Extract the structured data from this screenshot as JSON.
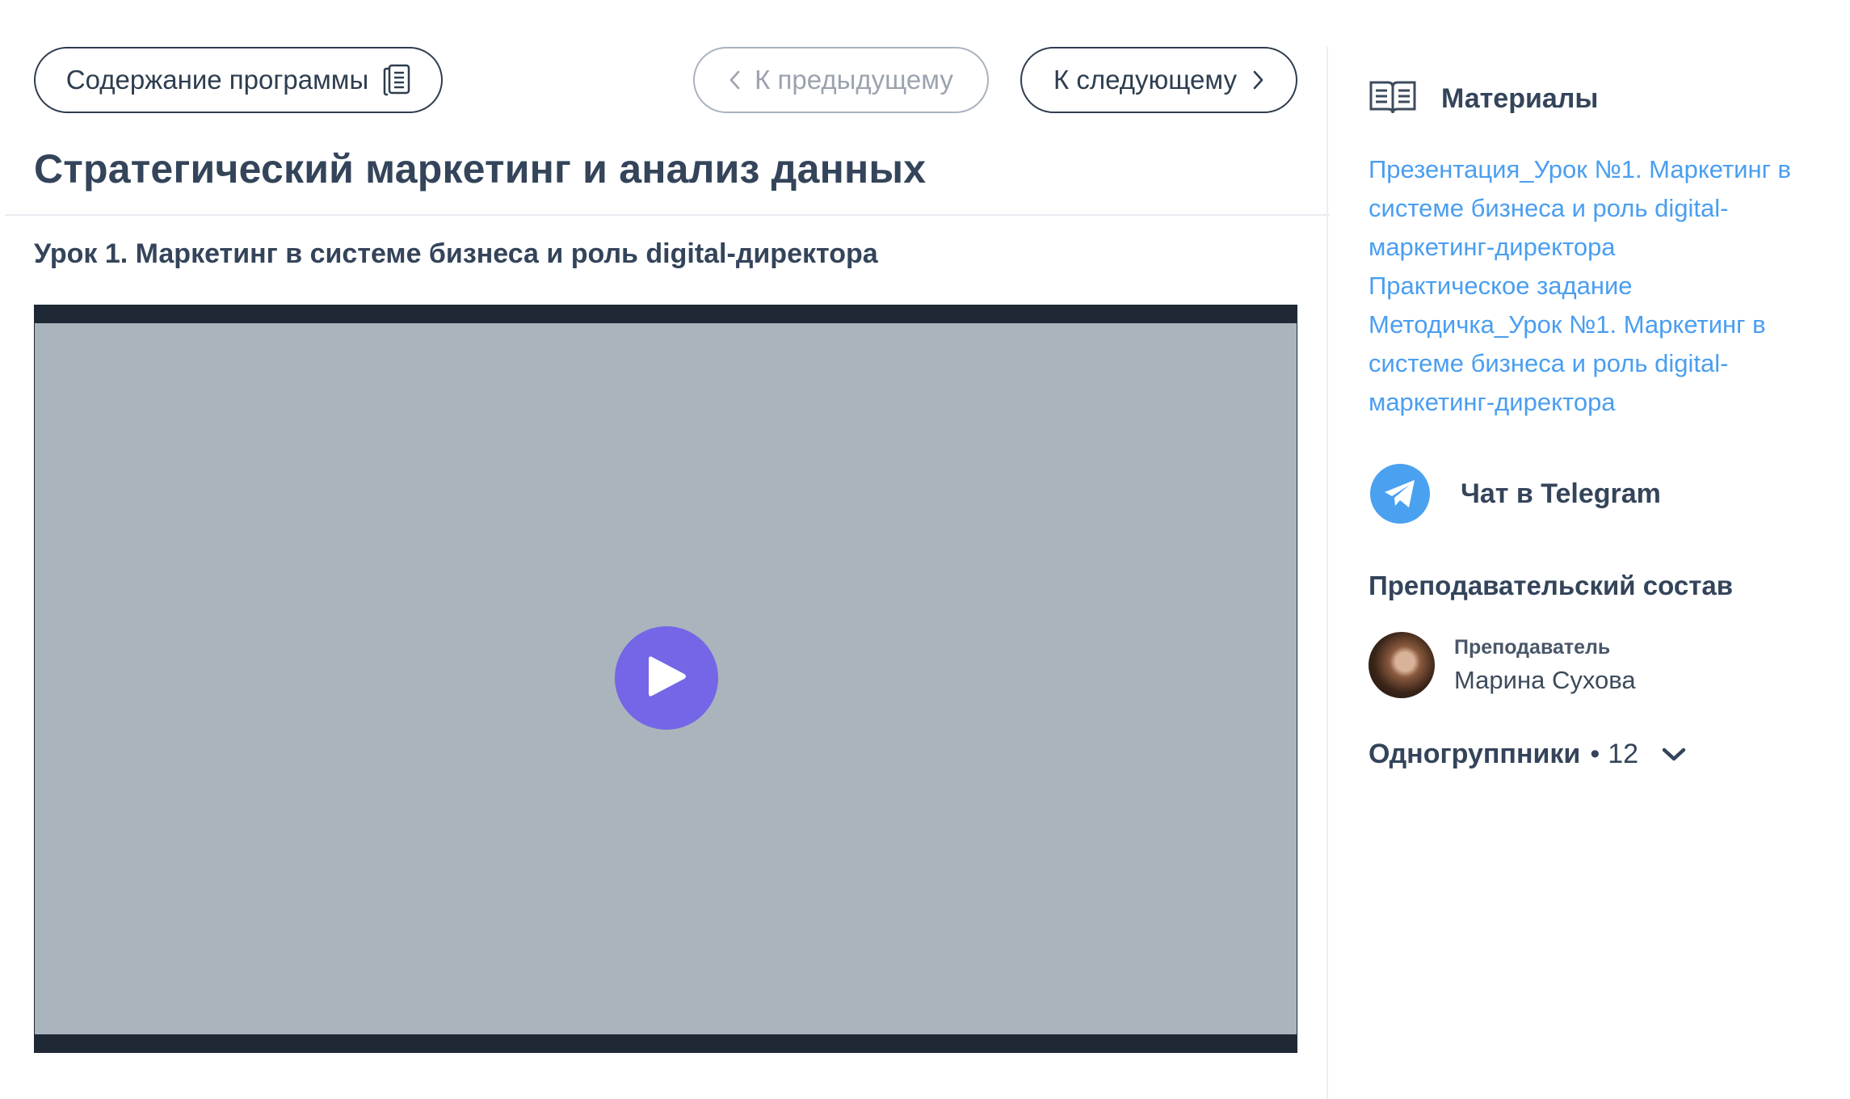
{
  "nav": {
    "contents_label": "Содержание программы",
    "prev_label": "К предыдущему",
    "next_label": "К следующему"
  },
  "course": {
    "title": "Стратегический маркетинг и анализ данных",
    "lesson_title": "Урок 1. Маркетинг в системе бизнеса и роль digital-директора"
  },
  "video": {
    "play_icon": "play-icon",
    "accent_color": "#7466e6"
  },
  "sidebar": {
    "materials_label": "Материалы",
    "materials": [
      {
        "label": "Презентация_Урок №1. Маркетинг в системе бизнеса и роль digital-маркетинг-директора"
      },
      {
        "label": "Практическое задание"
      },
      {
        "label": "Методичка_Урок №1. Маркетинг в системе бизнеса и роль digital-маркетинг-директора"
      }
    ],
    "telegram_label": "Чат в Telegram",
    "teachers_title": "Преподавательский состав",
    "teacher": {
      "role": "Преподаватель",
      "name": "Марина Сухова"
    },
    "classmates_label": "Одногруппники",
    "classmates_separator": "•",
    "classmates_count": "12"
  },
  "colors": {
    "link": "#4a9ef0",
    "text": "#34445a",
    "telegram": "#4aa1f0"
  }
}
